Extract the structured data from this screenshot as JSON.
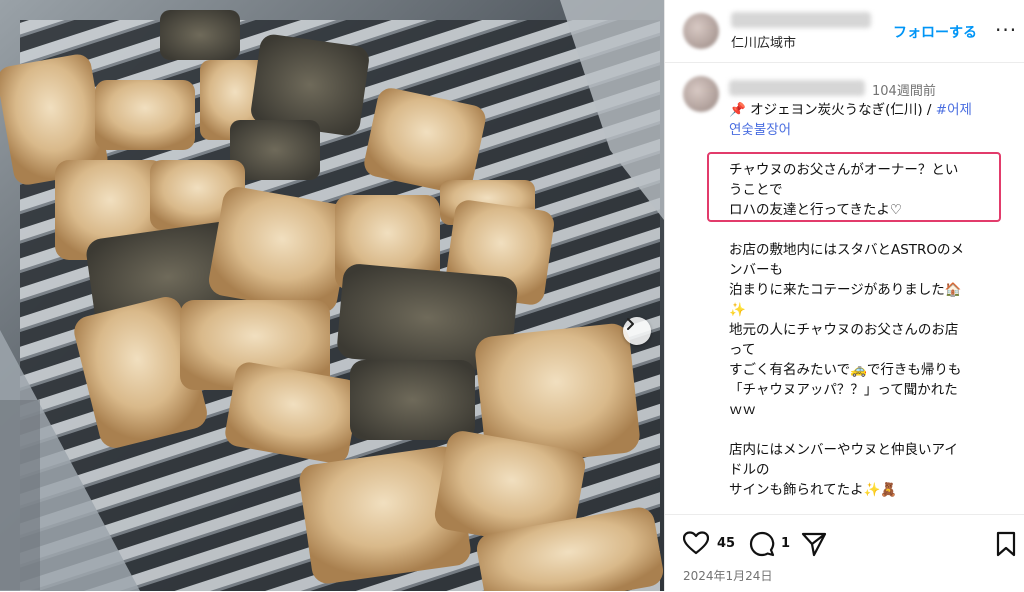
{
  "post": {
    "location": "仁川広域市",
    "follow_label": "フォローする",
    "more_label": "···",
    "time_ago": "104週間前",
    "title_line1": "📌 オジェヨン炭火うなぎ(仁川) / ",
    "hashtag1": "#어제",
    "hashtag2": "연숯불장어",
    "highlighted_lines": [
      "チャウヌのお父さんがオーナー？とい",
      "うことで",
      "ロハの友達と行ってきたよ♡"
    ],
    "body_lines": [
      "お店の敷地内にはスタバとASTROのメ",
      "ンバーも",
      "泊まりに来たコテージがありました🏠",
      "✨",
      "地元の人にチャウヌのお父さんのお店",
      "って",
      "すごく有名みたいで🚕で行きも帰りも",
      "「チャウヌアッパ？？」って聞かれた",
      "ｗｗ",
      "",
      "店内にはメンバーやウヌと仲良いアイ",
      "ドルの",
      "サインも飾られてたよ✨🧸"
    ],
    "likes": "45",
    "comments": "1",
    "date": "2024年1月24日"
  },
  "icons": {
    "next": "chevron-right-icon",
    "like": "heart-icon",
    "comment": "comment-icon",
    "share": "send-icon",
    "save": "bookmark-icon"
  },
  "colors": {
    "follow": "#0095f6",
    "highlight_border": "#e23b6b",
    "hashtag": "#4a6ee0"
  }
}
